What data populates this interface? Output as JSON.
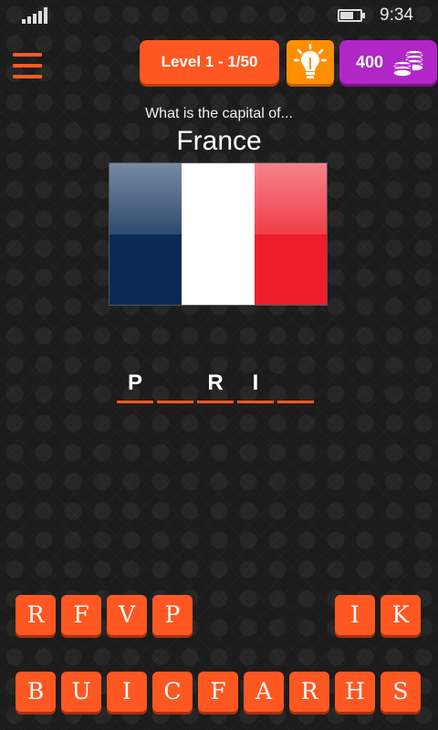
{
  "status_bar": {
    "time": "9:34",
    "signal_icon": "signal-bars-icon",
    "battery_icon": "battery-charging-icon"
  },
  "header": {
    "menu_icon": "hamburger-menu-icon",
    "level_label": "Level 1 - 1/50",
    "hint_icon": "lightbulb-icon",
    "coins": "400",
    "coins_icon": "coin-stack-icon"
  },
  "question": {
    "prompt": "What is the capital of...",
    "country": "France"
  },
  "flag": {
    "colors": [
      "#0a2a55",
      "#ffffff",
      "#ef1c2a"
    ]
  },
  "answer": {
    "slots": [
      "P",
      "",
      "R",
      "I",
      ""
    ]
  },
  "keyboard": {
    "row1": [
      "R",
      "F",
      "V",
      "P",
      "",
      "",
      "",
      "I",
      "K"
    ],
    "row2": [
      "B",
      "U",
      "I",
      "C",
      "F",
      "A",
      "R",
      "H",
      "S"
    ]
  },
  "colors": {
    "accent": "#ff5722",
    "hint": "#ff8f00",
    "coins": "#b026c6"
  }
}
